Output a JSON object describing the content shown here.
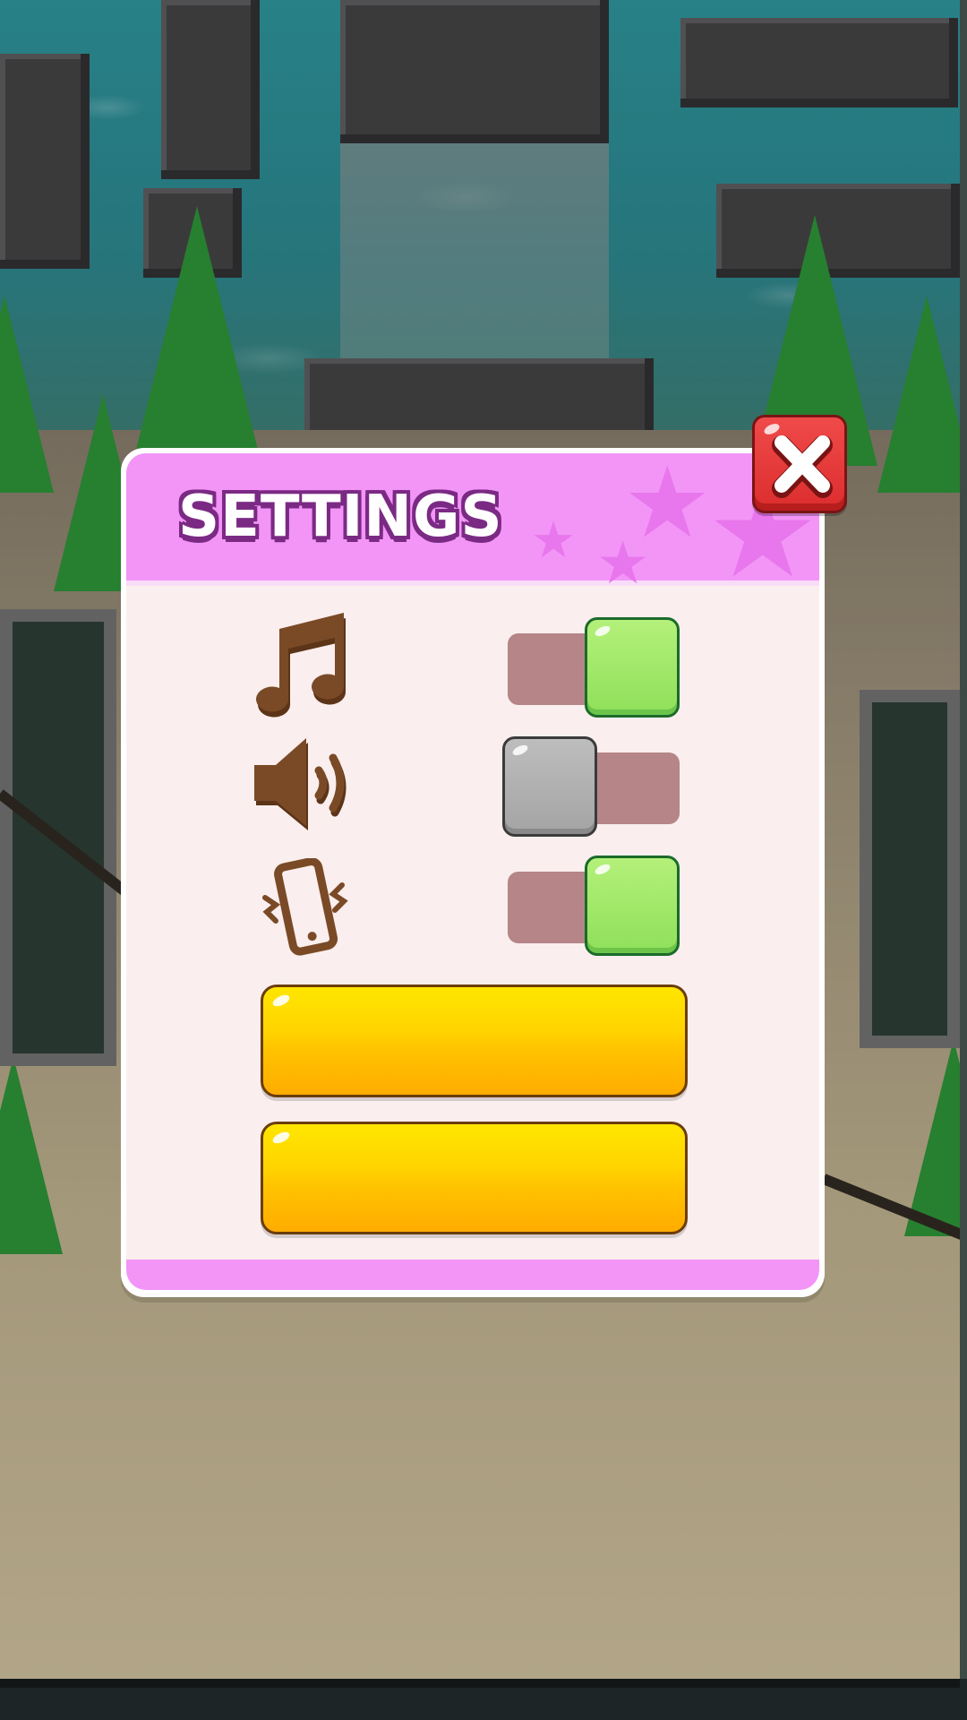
{
  "dialog": {
    "title": "SETTINGS",
    "close_icon": "close-x-icon"
  },
  "settings": [
    {
      "id": "music",
      "icon": "music-note-icon",
      "state": "on"
    },
    {
      "id": "sound",
      "icon": "speaker-icon",
      "state": "off"
    },
    {
      "id": "vibration",
      "icon": "vibrate-phone-icon",
      "state": "on"
    }
  ],
  "buttons": [
    {
      "id": "button-1",
      "label": ""
    },
    {
      "id": "button-2",
      "label": ""
    }
  ],
  "colors": {
    "header": "#f295f7",
    "panel": "#faeeee",
    "toggle_on": "#8fe05a",
    "toggle_off": "#a4a4a4",
    "track": "#b58588",
    "close_button": "#e03333",
    "yellow_button": "#ffc200",
    "icon_brown": "#7a4a26"
  }
}
